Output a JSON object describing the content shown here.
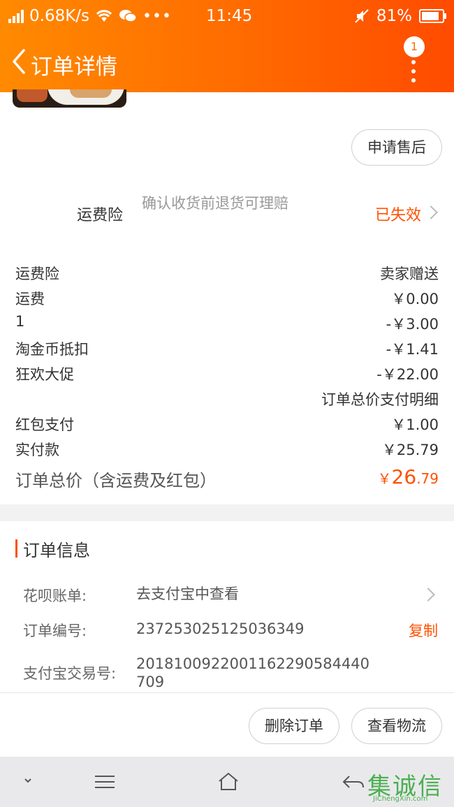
{
  "status_bar": {
    "speed": "0.68K/s",
    "time": "11:45",
    "battery": "81%"
  },
  "navbar": {
    "title": "订单详情",
    "badge": "1"
  },
  "after_sale_button": "申请售后",
  "insurance": {
    "label": "运费险",
    "description": "确认收货前退货可理赔",
    "status": "已失效"
  },
  "price_rows": [
    {
      "label": "运费险",
      "value": "卖家赠送"
    },
    {
      "label": "运费",
      "value": "￥0.00"
    },
    {
      "label": "1",
      "value": "-￥3.00"
    },
    {
      "label": "淘金币抵扣",
      "value": "-￥1.41"
    },
    {
      "label": "狂欢大促",
      "value": "-￥22.00"
    },
    {
      "label": "",
      "value": "订单总价支付明细"
    },
    {
      "label": "红包支付",
      "value": "￥1.00"
    },
    {
      "label": "实付款",
      "value": "￥25.79"
    }
  ],
  "total": {
    "label": "订单总价（含运费及红包）",
    "currency": "￥",
    "integer": "26",
    "decimal": ".79"
  },
  "order_info": {
    "title": "订单信息",
    "rows": [
      {
        "key": "花呗账单:",
        "value": "去支付宝中查看"
      },
      {
        "key": "订单编号:",
        "value": "237253025125036349"
      },
      {
        "key": "支付宝交易号:",
        "value": "2018100922001162290584440709"
      }
    ],
    "copy_label": "复制"
  },
  "actions": {
    "delete": "删除订单",
    "logistics": "查看物流"
  },
  "watermark": {
    "title": "集诚信",
    "site": "JiChengXin.com"
  },
  "colors": {
    "accent": "#ff5000",
    "header_start": "#ff8a00",
    "header_end": "#ff4b00"
  },
  "icons": [
    "signal-icon",
    "wifi-icon",
    "wechat-icon",
    "mute-icon",
    "battery-icon",
    "back-icon",
    "more-icon",
    "chevron-right-icon",
    "collapse-icon",
    "menu-icon",
    "home-icon",
    "return-icon"
  ]
}
